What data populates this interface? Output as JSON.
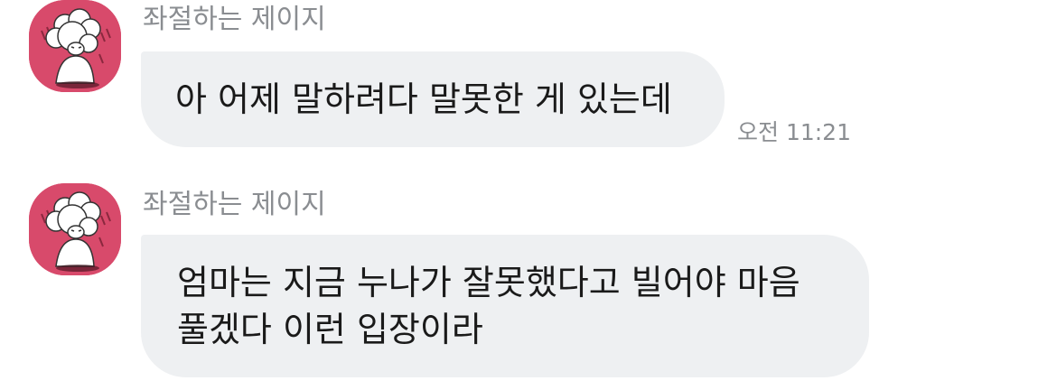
{
  "messages": [
    {
      "sender": "좌절하는 제이지",
      "avatar_icon": "frustrated-character-avatar-icon",
      "lines": [
        "아 어제 말하려다 말못한 게 있는데"
      ],
      "time": "오전 11:21"
    },
    {
      "sender": "좌절하는 제이지",
      "avatar_icon": "frustrated-character-avatar-icon",
      "lines": [
        "엄마는 지금 누나가 잘못했다고 빌어야 마음",
        "풀겠다 이런 입장이라"
      ]
    }
  ],
  "colors": {
    "bubble_bg": "#eef0f2",
    "avatar_bg": "#d84a6b",
    "secondary_text": "#8a8d91",
    "message_text": "#1a1a1a"
  }
}
